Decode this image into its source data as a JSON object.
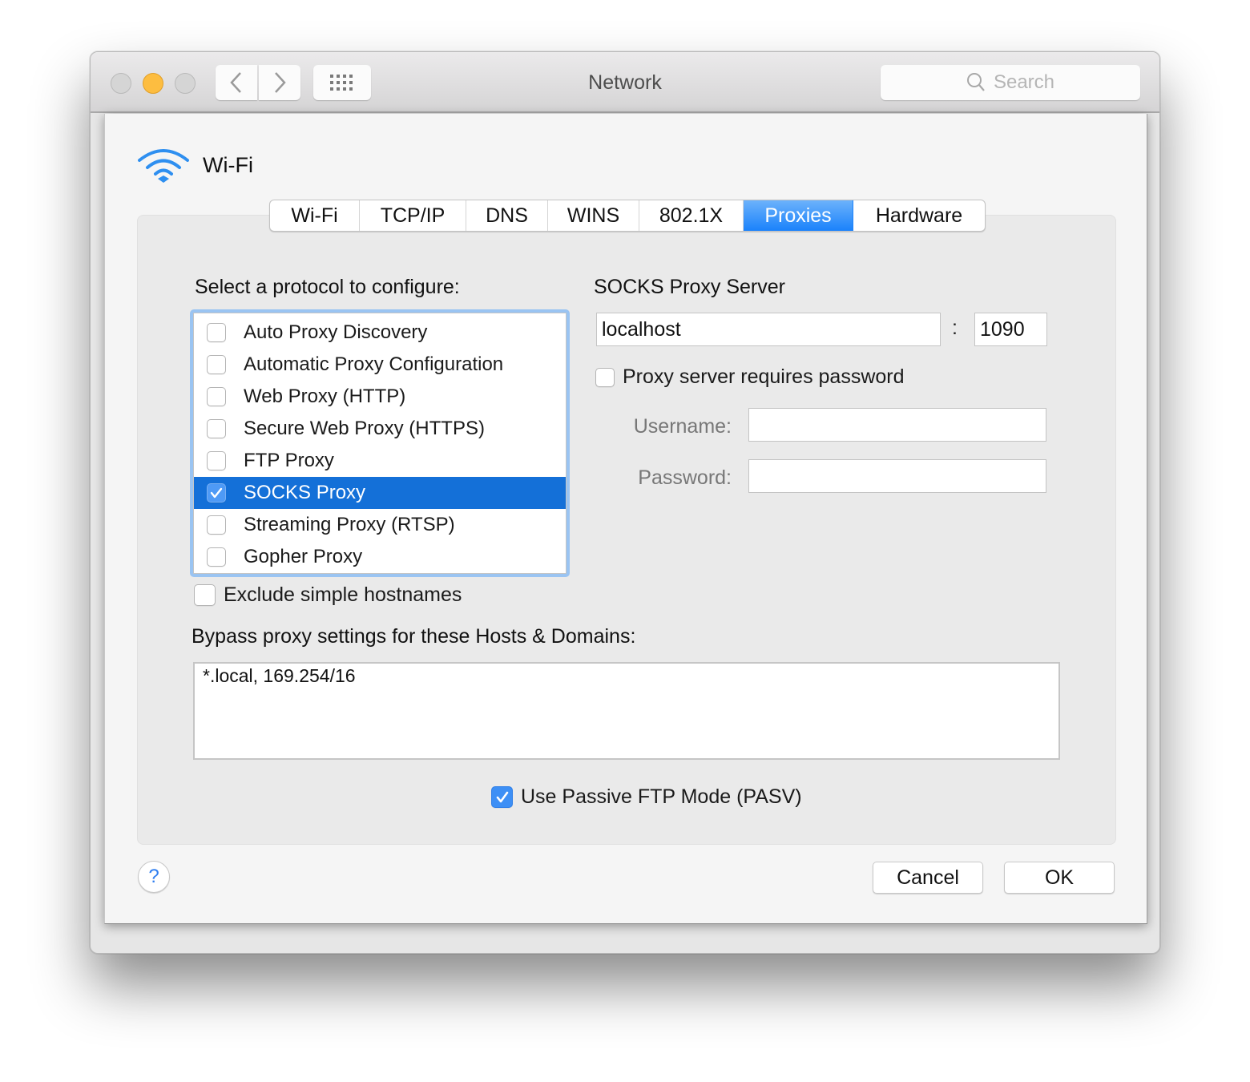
{
  "window": {
    "title": "Network",
    "search_placeholder": "Search",
    "icons": {
      "close": "close-button",
      "minimize": "minimize-button",
      "zoom": "zoom-button",
      "back": "chevron-left-icon",
      "forward": "chevron-right-icon",
      "grid": "grid-icon",
      "search": "magnifier-icon"
    }
  },
  "sheet": {
    "interface_name": "Wi-Fi",
    "interface_icon": "wifi-icon",
    "tabs": [
      {
        "label": "Wi-Fi",
        "active": false
      },
      {
        "label": "TCP/IP",
        "active": false
      },
      {
        "label": "DNS",
        "active": false
      },
      {
        "label": "WINS",
        "active": false
      },
      {
        "label": "802.1X",
        "active": false
      },
      {
        "label": "Proxies",
        "active": true
      },
      {
        "label": "Hardware",
        "active": false
      }
    ],
    "protocol_label": "Select a protocol to configure:",
    "protocols": [
      {
        "label": "Auto Proxy Discovery",
        "checked": false,
        "selected": false
      },
      {
        "label": "Automatic Proxy Configuration",
        "checked": false,
        "selected": false
      },
      {
        "label": "Web Proxy (HTTP)",
        "checked": false,
        "selected": false
      },
      {
        "label": "Secure Web Proxy (HTTPS)",
        "checked": false,
        "selected": false
      },
      {
        "label": "FTP Proxy",
        "checked": false,
        "selected": false
      },
      {
        "label": "SOCKS Proxy",
        "checked": true,
        "selected": true
      },
      {
        "label": "Streaming Proxy (RTSP)",
        "checked": false,
        "selected": false
      },
      {
        "label": "Gopher Proxy",
        "checked": false,
        "selected": false
      }
    ],
    "server": {
      "heading": "SOCKS Proxy Server",
      "host": "localhost",
      "separator": ":",
      "port": "1090",
      "requires_password_label": "Proxy server requires password",
      "requires_password": false,
      "username_label": "Username:",
      "username": "",
      "password_label": "Password:",
      "password": ""
    },
    "exclude_simple_label": "Exclude simple hostnames",
    "exclude_simple": false,
    "bypass_label": "Bypass proxy settings for these Hosts & Domains:",
    "bypass_value": "*.local, 169.254/16",
    "passive_ftp_label": "Use Passive FTP Mode (PASV)",
    "passive_ftp": true,
    "help_label": "?",
    "cancel_label": "Cancel",
    "ok_label": "OK"
  },
  "colors": {
    "accent": "#1a82fb",
    "selection": "#1470d8",
    "focus_ring": "#9ac4f2",
    "minimize": "#fdbd40"
  }
}
